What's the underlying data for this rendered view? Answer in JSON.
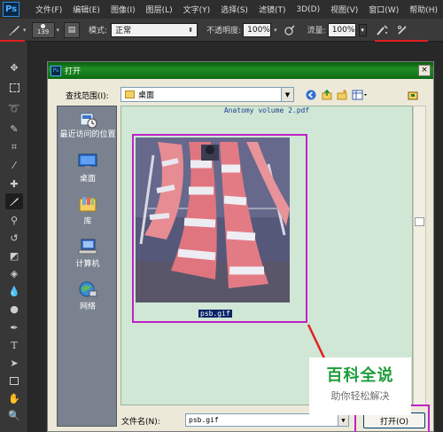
{
  "app": {
    "logo": "Ps"
  },
  "menu": {
    "items": [
      "文件(F)",
      "编辑(E)",
      "图像(I)",
      "图层(L)",
      "文字(Y)",
      "选择(S)",
      "滤镜(T)",
      "3D(D)",
      "视图(V)",
      "窗口(W)",
      "帮助(H)"
    ]
  },
  "options": {
    "brush_size": "139",
    "mode_label": "模式:",
    "mode_value": "正常",
    "opacity_label": "不透明度:",
    "opacity_value": "100%",
    "flow_label": "流量:",
    "flow_value": "100%"
  },
  "dialog": {
    "title": "打开",
    "close": "×",
    "lookin_label": "查找范围(I):",
    "lookin_value": "桌面",
    "places": [
      {
        "label": "最近访问的位置",
        "icon": "recent-places-icon"
      },
      {
        "label": "桌面",
        "icon": "desktop-icon"
      },
      {
        "label": "库",
        "icon": "libraries-icon"
      },
      {
        "label": "计算机",
        "icon": "computer-icon"
      },
      {
        "label": "网络",
        "icon": "network-icon"
      }
    ],
    "files": {
      "top_name": "Anatomy volume 2.pdf",
      "selected_name": "psb.gif"
    },
    "filename_label": "文件名(N):",
    "filename_value": "psb.gif",
    "open_button": "打开(O)"
  },
  "watermark": {
    "title": "百科全说",
    "subtitle": "助你轻松解决"
  },
  "colors": {
    "highlight": "#c021c6",
    "arrow": "#e22020",
    "watermark_green": "#1e9c3a"
  }
}
